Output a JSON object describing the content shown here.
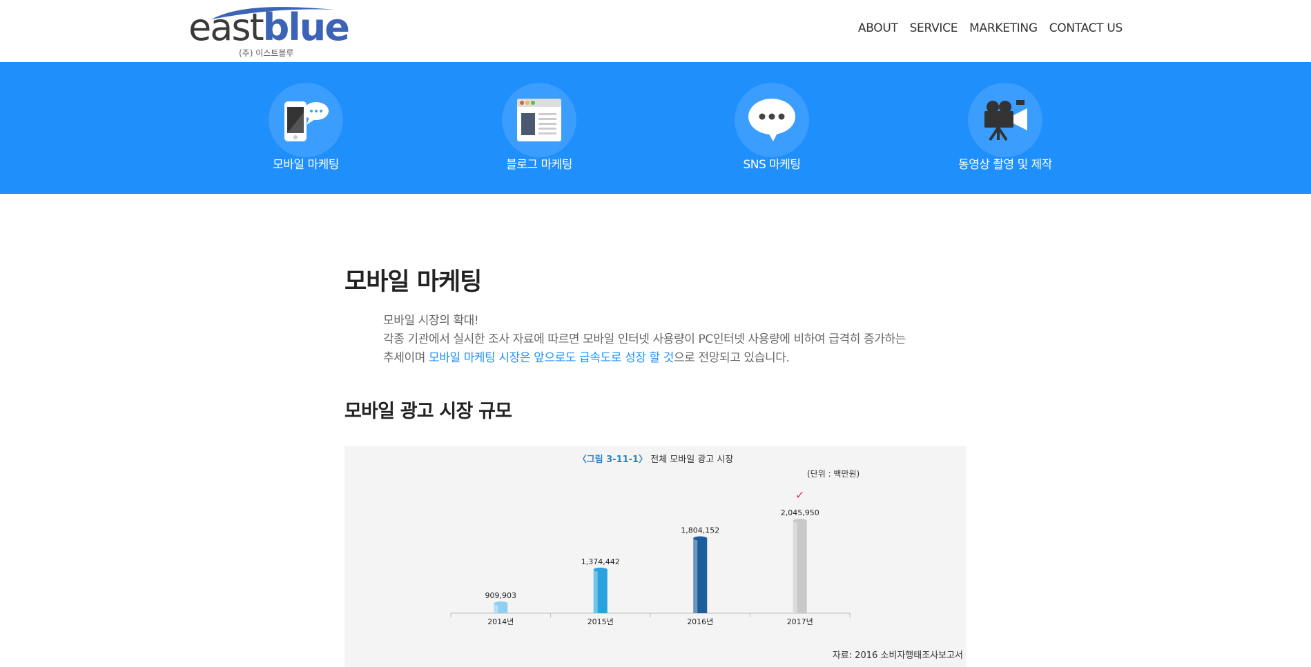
{
  "header": {
    "logo": {
      "east": "east",
      "blue": "blue",
      "sub": "(주) 이스트블루"
    },
    "nav": [
      "ABOUT",
      "SERVICE",
      "MARKETING",
      "CONTACT US"
    ]
  },
  "services": [
    {
      "label": "모바일 마케팅",
      "icon": "mobile-chat-icon"
    },
    {
      "label": "블로그 마케팅",
      "icon": "blog-page-icon"
    },
    {
      "label": "SNS 마케팅",
      "icon": "speech-bubble-icon"
    },
    {
      "label": "동영상 촬영 및 제작",
      "icon": "video-camera-icon"
    }
  ],
  "content": {
    "title": "모바일 마케팅",
    "intro_line1": "모바일 시장의 확대!",
    "intro_line2": "각종 기관에서 실시한 조사 자료에 따르면 모바일 인터넷 사용량이 PC인터넷 사용량에 비하여 급격히 증가하는",
    "intro_line3_a": "추세이며 ",
    "intro_line3_highlight": "모바일 마케팅 시장은 앞으로도 급속도로 성장 할 것",
    "intro_line3_b": "으로 전망되고 있습니다.",
    "subtitle": "모바일 광고 시장 규모"
  },
  "colors": {
    "band": "#1f8ffc",
    "highlight": "#1f8ffc",
    "logo_blue": "#3b63b7"
  },
  "chart_data": {
    "type": "bar",
    "title_fig": "〈그림 3-11-1〉",
    "title": "전체 모바일 광고 시장",
    "unit": "(단위 : 백만원)",
    "categories": [
      "2014년",
      "2015년",
      "2016년",
      "2017년"
    ],
    "values": [
      909903,
      1374442,
      1804152,
      2045950
    ],
    "value_labels": [
      "909,903",
      "1,374,442",
      "1,804,152",
      "2,045,950"
    ],
    "source": "자료: 2016 소비자행태조사보고서",
    "bar_colors": [
      "#8fd0f0",
      "#2aa3dc",
      "#1e5d9c",
      "#c8c8c8"
    ],
    "checkmark": "✓",
    "ylim": [
      0,
      2200000
    ]
  }
}
